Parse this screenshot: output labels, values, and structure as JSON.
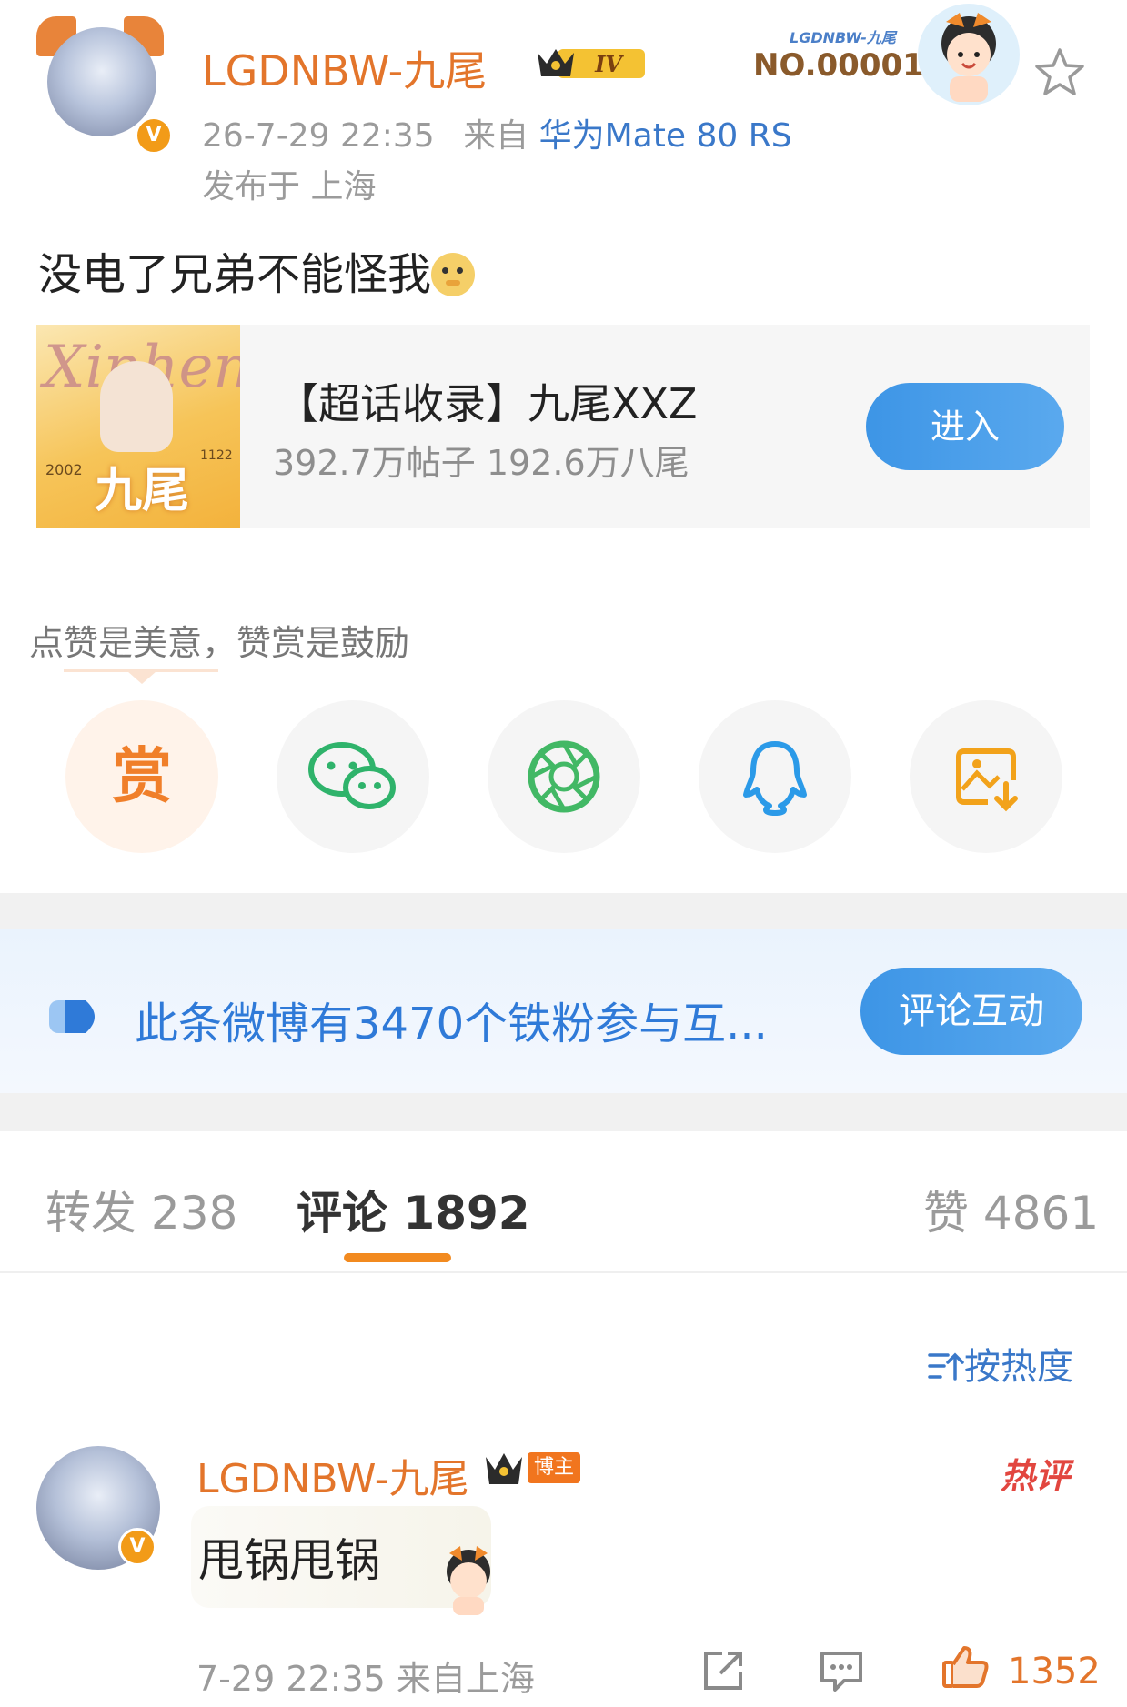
{
  "post": {
    "username": "LGDNBW-九尾",
    "level_badge": "IV",
    "time": "26-7-29 22:35",
    "from_label": "来自",
    "device": "华为Mate 80 RS",
    "location": "发布于 上海",
    "fan_tag": "LGDNBW-九尾",
    "fan_number": "NO.00001",
    "text": "没电了兄弟不能怪我"
  },
  "super_topic": {
    "title": "【超话收录】九尾XXZ",
    "stats": "392.7万帖子 192.6万八尾",
    "button": "进入",
    "cover_text": "九尾",
    "cover_script": "Xinhen",
    "cover_left_num": "2002",
    "cover_right_num": "1122"
  },
  "reward": {
    "prompt": "点赞是美意，赞赏是鼓励",
    "buttons": [
      {
        "label": "赏",
        "icon": "reward-icon"
      },
      {
        "icon": "wechat-icon"
      },
      {
        "icon": "moments-icon"
      },
      {
        "icon": "qq-icon"
      },
      {
        "icon": "save-image-icon"
      }
    ]
  },
  "fans_banner": {
    "text": "此条微博有3470个铁粉参与互...",
    "button": "评论互动"
  },
  "tabs": {
    "repost": "转发 238",
    "comment": "评论 1892",
    "like": "赞 4861",
    "active": "comment"
  },
  "sort": {
    "label": "按热度",
    "icon": "sort-icon"
  },
  "comment": {
    "username": "LGDNBW-九尾",
    "badge": "博主",
    "hot_label": "热评",
    "text": "甩锅甩锅",
    "meta": "7-29 22:35 来自上海",
    "likes": "1352"
  },
  "colors": {
    "username": "#e3752b",
    "link_blue": "#3a78c9",
    "button_blue": "#3d95e6",
    "tab_indicator": "#f28a1f",
    "hot_red": "#e2463f"
  }
}
